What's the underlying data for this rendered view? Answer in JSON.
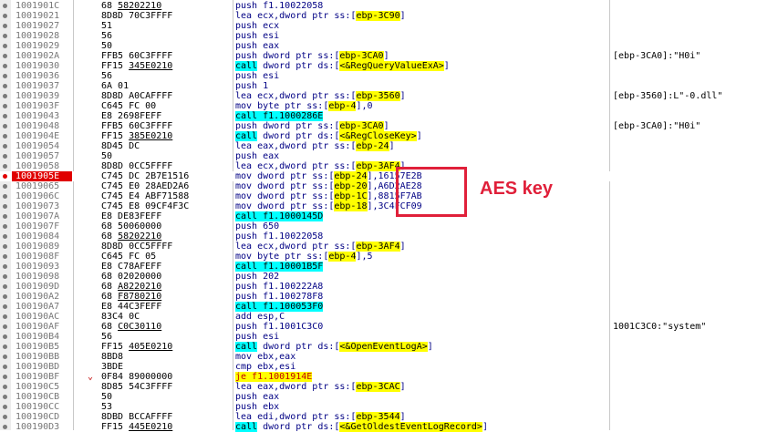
{
  "rows": [
    {
      "addr": "1001901C",
      "bytes": "68 58202210",
      "bu": "58202210",
      "instr": "push f1.10022058",
      "type": "plain",
      "comment": ""
    },
    {
      "addr": "10019021",
      "bytes": "8D8D 70C3FFFF",
      "instr": "lea ecx,dword ptr ss:[ebp-3C90]",
      "type": "plain",
      "comment": ""
    },
    {
      "addr": "10019027",
      "bytes": "51",
      "instr": "push ecx",
      "type": "plain",
      "comment": ""
    },
    {
      "addr": "10019028",
      "bytes": "56",
      "instr": "push esi",
      "type": "plain",
      "comment": ""
    },
    {
      "addr": "10019029",
      "bytes": "50",
      "instr": "push eax",
      "type": "plain",
      "comment": ""
    },
    {
      "addr": "1001902A",
      "bytes": "FFB5 60C3FFFF",
      "instr": "push dword ptr ss:[ebp-3CA0]",
      "type": "plain",
      "comment": "[ebp-3CA0]:\"H0i\""
    },
    {
      "addr": "10019030",
      "bytes": "FF15 345E0210",
      "bu": "345E0210",
      "instr": "call dword ptr ds:[<&RegQueryValueExA>]",
      "type": "callimp",
      "comment": ""
    },
    {
      "addr": "10019036",
      "bytes": "56",
      "instr": "push esi",
      "type": "plain",
      "comment": ""
    },
    {
      "addr": "10019037",
      "bytes": "6A 01",
      "instr": "push 1",
      "type": "plain",
      "comment": ""
    },
    {
      "addr": "10019039",
      "bytes": "8D8D A0CAFFFF",
      "instr": "lea ecx,dword ptr ss:[ebp-3560]",
      "type": "plain",
      "comment": "[ebp-3560]:L\"-0.dll\""
    },
    {
      "addr": "1001903F",
      "bytes": "C645 FC 00",
      "instr": "mov byte ptr ss:[ebp-4],0",
      "type": "plain",
      "comment": ""
    },
    {
      "addr": "10019043",
      "bytes": "E8 2698FEFF",
      "instr": "call f1.1000286E",
      "type": "calldir",
      "comment": ""
    },
    {
      "addr": "10019048",
      "bytes": "FFB5 60C3FFFF",
      "instr": "push dword ptr ss:[ebp-3CA0]",
      "type": "plain",
      "comment": "[ebp-3CA0]:\"H0i\""
    },
    {
      "addr": "1001904E",
      "bytes": "FF15 385E0210",
      "bu": "385E0210",
      "instr": "call dword ptr ds:[<&RegCloseKey>]",
      "type": "callimp",
      "comment": ""
    },
    {
      "addr": "10019054",
      "bytes": "8D45 DC",
      "instr": "lea eax,dword ptr ss:[ebp-24]",
      "type": "plain",
      "comment": ""
    },
    {
      "addr": "10019057",
      "bytes": "50",
      "instr": "push eax",
      "type": "plain",
      "comment": ""
    },
    {
      "addr": "10019058",
      "bytes": "8D8D 0CC5FFFF",
      "instr": "lea ecx,dword ptr ss:[ebp-3AF4]",
      "type": "plain",
      "comment": ""
    },
    {
      "addr": "1001905E",
      "bytes": "C745 DC 2B7E1516",
      "instr": "mov dword ptr ss:[ebp-24],16157E2B",
      "type": "plain",
      "comment": "",
      "sel": true
    },
    {
      "addr": "10019065",
      "bytes": "C745 E0 28AED2A6",
      "instr": "mov dword ptr ss:[ebp-20],A6D2AE28",
      "type": "plain",
      "comment": ""
    },
    {
      "addr": "1001906C",
      "bytes": "C745 E4 ABF71588",
      "instr": "mov dword ptr ss:[ebp-1C],8815F7AB",
      "type": "plain",
      "comment": ""
    },
    {
      "addr": "10019073",
      "bytes": "C745 E8 09CF4F3C",
      "instr": "mov dword ptr ss:[ebp-18],3C4FCF09",
      "type": "plain",
      "comment": ""
    },
    {
      "addr": "1001907A",
      "bytes": "E8 DE83FEFF",
      "instr": "call f1.1000145D",
      "type": "calldir",
      "comment": ""
    },
    {
      "addr": "1001907F",
      "bytes": "68 50060000",
      "instr": "push 650",
      "type": "plain",
      "comment": ""
    },
    {
      "addr": "10019084",
      "bytes": "68 58202210",
      "bu": "58202210",
      "instr": "push f1.10022058",
      "type": "plain",
      "comment": ""
    },
    {
      "addr": "10019089",
      "bytes": "8D8D 0CC5FFFF",
      "instr": "lea ecx,dword ptr ss:[ebp-3AF4]",
      "type": "plain",
      "comment": ""
    },
    {
      "addr": "1001908F",
      "bytes": "C645 FC 05",
      "instr": "mov byte ptr ss:[ebp-4],5",
      "type": "plain",
      "comment": ""
    },
    {
      "addr": "10019093",
      "bytes": "E8 C78AFEFF",
      "instr": "call f1.10001B5F",
      "type": "calldir",
      "comment": ""
    },
    {
      "addr": "10019098",
      "bytes": "68 02020000",
      "instr": "push 202",
      "type": "plain",
      "comment": ""
    },
    {
      "addr": "1001909D",
      "bytes": "68 A8220210",
      "bu": "A8220210",
      "instr": "push f1.100222A8",
      "type": "plain",
      "comment": ""
    },
    {
      "addr": "100190A2",
      "bytes": "68 F8780210",
      "bu": "F8780210",
      "instr": "push f1.100278F8",
      "type": "plain",
      "comment": ""
    },
    {
      "addr": "100190A7",
      "bytes": "E8 44C3FEFF",
      "instr": "call f1.100053F0",
      "type": "calldir",
      "comment": ""
    },
    {
      "addr": "100190AC",
      "bytes": "83C4 0C",
      "instr": "add esp,C",
      "type": "plain",
      "comment": ""
    },
    {
      "addr": "100190AF",
      "bytes": "68 C0C30110",
      "bu": "C0C30110",
      "instr": "push f1.1001C3C0",
      "type": "plain",
      "comment": "1001C3C0:\"system\""
    },
    {
      "addr": "100190B4",
      "bytes": "56",
      "instr": "push esi",
      "type": "plain",
      "comment": ""
    },
    {
      "addr": "100190B5",
      "bytes": "FF15 405E0210",
      "bu": "405E0210",
      "instr": "call dword ptr ds:[<&OpenEventLogA>]",
      "type": "callimp",
      "comment": ""
    },
    {
      "addr": "100190BB",
      "bytes": "8BD8",
      "instr": "mov ebx,eax",
      "type": "plain",
      "comment": ""
    },
    {
      "addr": "100190BD",
      "bytes": "3BDE",
      "instr": "cmp ebx,esi",
      "type": "plain",
      "comment": ""
    },
    {
      "addr": "100190BF",
      "bytes": "0F84 89000000",
      "instr": "je f1.1001914E",
      "type": "jump",
      "comment": "",
      "arrow": true
    },
    {
      "addr": "100190C5",
      "bytes": "8D85 54C3FFFF",
      "instr": "lea eax,dword ptr ss:[ebp-3CAC]",
      "type": "plain",
      "comment": ""
    },
    {
      "addr": "100190CB",
      "bytes": "50",
      "instr": "push eax",
      "type": "plain",
      "comment": ""
    },
    {
      "addr": "100190CC",
      "bytes": "53",
      "instr": "push ebx",
      "type": "plain",
      "comment": ""
    },
    {
      "addr": "100190CD",
      "bytes": "8DBD BCCAFFFF",
      "instr": "lea edi,dword ptr ss:[ebp-3544]",
      "type": "plain",
      "comment": ""
    },
    {
      "addr": "100190D3",
      "bytes": "FF15 445E0210",
      "bu": "445E0210",
      "instr": "call dword ptr ds:[<&GetOldestEventLogRecord>]",
      "type": "callimp",
      "comment": ""
    }
  ],
  "annotation": {
    "label": "AES key"
  }
}
